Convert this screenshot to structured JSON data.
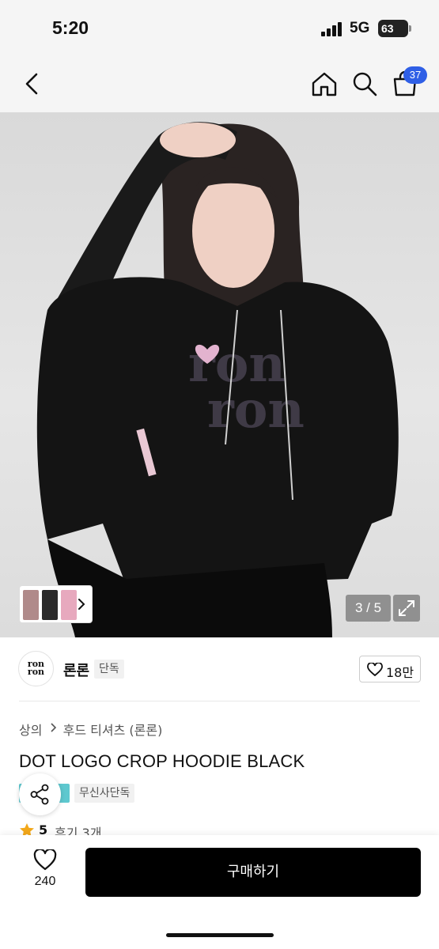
{
  "status_bar": {
    "time": "5:20",
    "network": "5G",
    "battery": "63"
  },
  "nav": {
    "back_icon": "chevron-left-icon",
    "home_icon": "home-icon",
    "search_icon": "search-icon",
    "cart_icon": "cart-icon",
    "cart_count": "37"
  },
  "gallery": {
    "counter": "3 / 5",
    "expand_icon": "expand-icon"
  },
  "brand": {
    "logo_text_1": "ron",
    "logo_text_2": "ron",
    "name": "론론",
    "exclusive_label": "단독",
    "likes": "18만"
  },
  "breadcrumb": {
    "category": "상의",
    "subcategory": "후드 티셔츠 (론론)"
  },
  "product": {
    "title": "DOT LOGO CROP HOODIE BLACK",
    "exclusive_tag": "무신사단독"
  },
  "rating": {
    "score": "5",
    "reviews": "후기 3개"
  },
  "bottom_bar": {
    "wish_count": "240",
    "buy_label": "구매하기"
  },
  "colors": {
    "accent_blue": "#2f5fe6",
    "buy_button": "#000000",
    "musinsa_tag": "#5ec8cf"
  }
}
